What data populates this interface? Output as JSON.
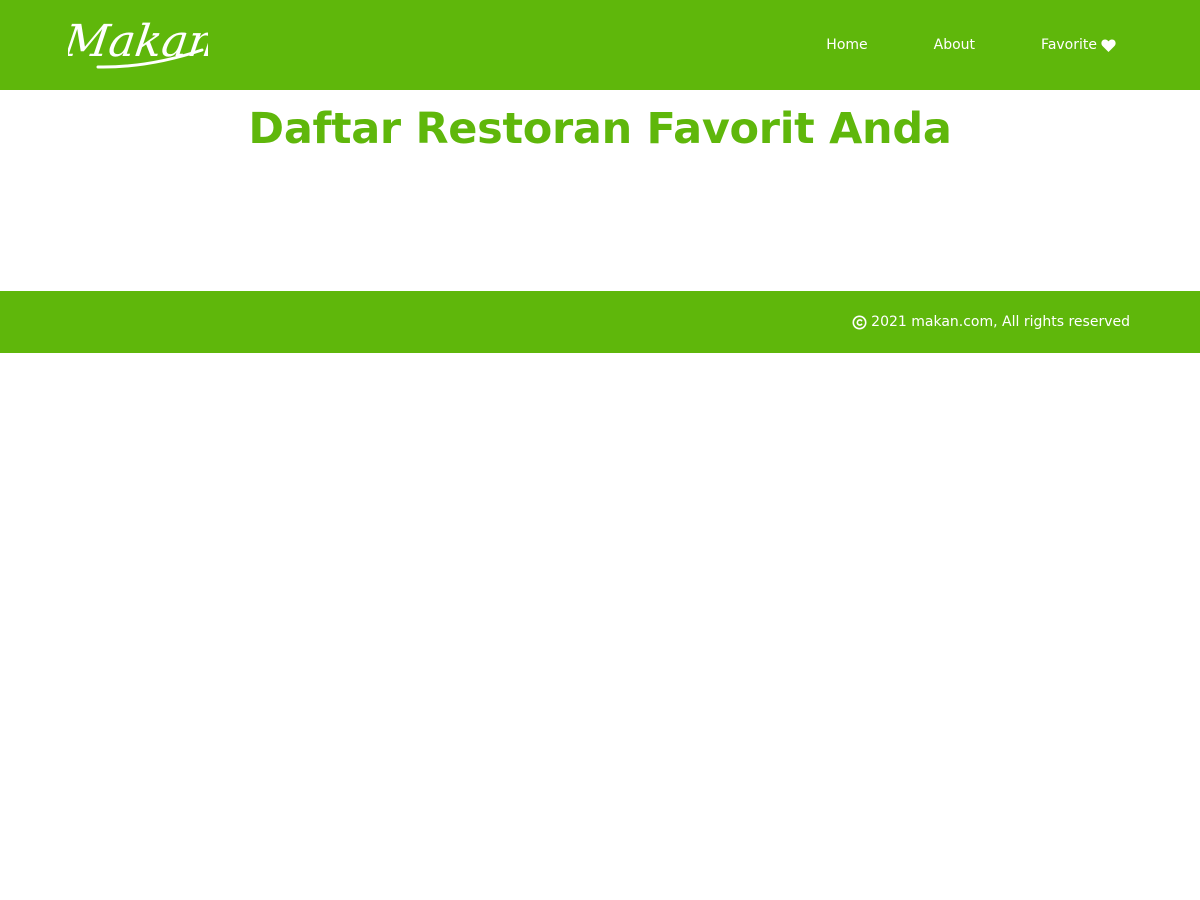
{
  "colors": {
    "brand_green": "#5fb70b",
    "white": "#ffffff"
  },
  "header": {
    "logo_text": "Makan",
    "nav": [
      {
        "label": "Home"
      },
      {
        "label": "About"
      },
      {
        "label": "Favorite",
        "icon": "heart-icon"
      }
    ]
  },
  "main": {
    "title": "Daftar Restoran Favorit Anda"
  },
  "footer": {
    "icon": "copyright-icon",
    "text": "2021 makan.com, All rights reserved"
  }
}
